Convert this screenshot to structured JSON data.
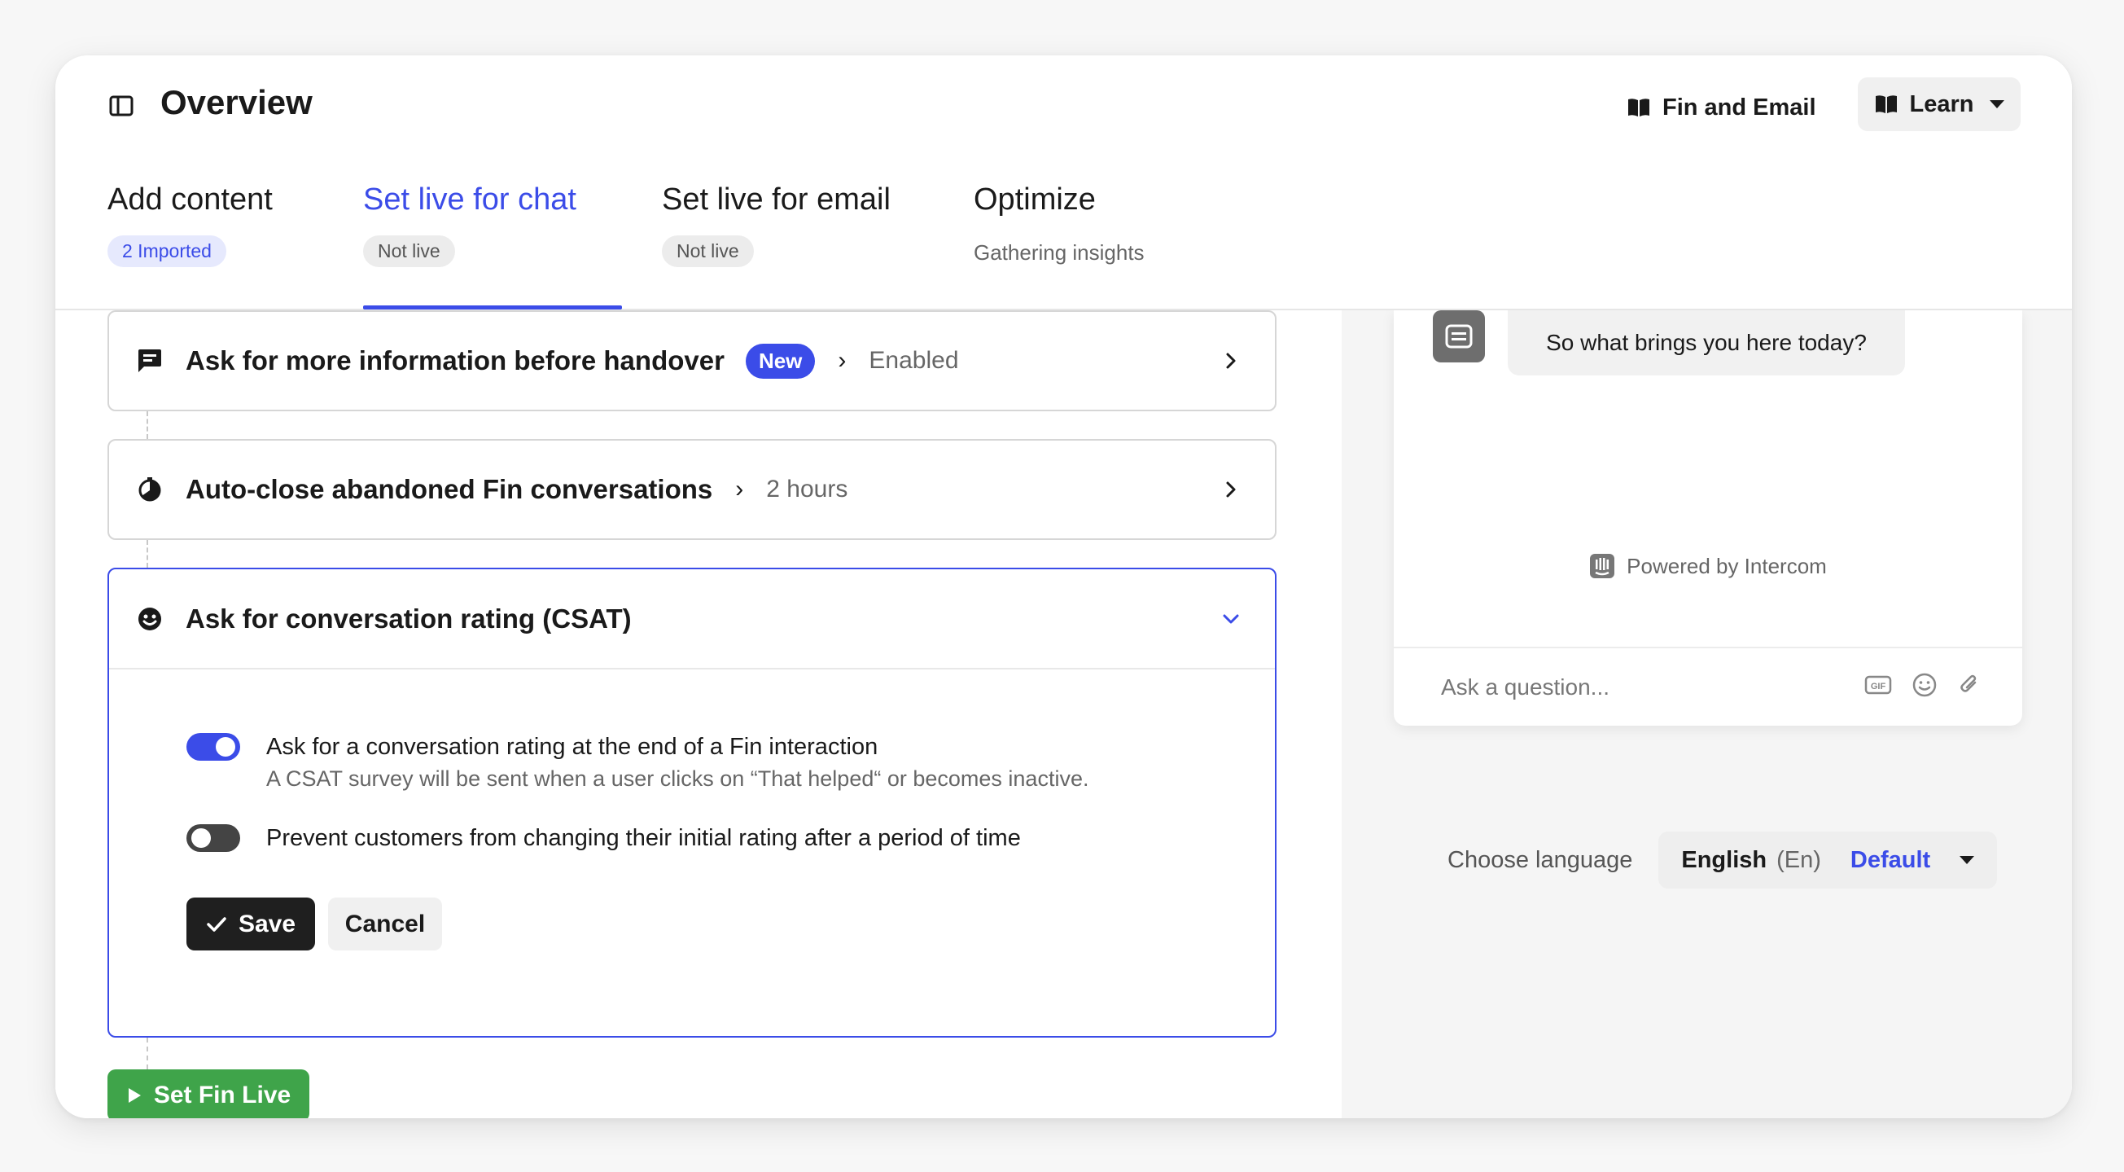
{
  "header": {
    "title": "Overview",
    "fin_email_label": "Fin and Email",
    "learn_label": "Learn"
  },
  "tabs": [
    {
      "label": "Add content",
      "badge": "2 Imported"
    },
    {
      "label": "Set live for chat",
      "badge": "Not live",
      "active": true
    },
    {
      "label": "Set live for email",
      "badge": "Not live"
    },
    {
      "label": "Optimize",
      "sub": "Gathering insights"
    }
  ],
  "cards": {
    "handover": {
      "title": "Ask for more information before handover",
      "pill": "New",
      "arrow": "›",
      "value": "Enabled"
    },
    "autoclose": {
      "title": "Auto-close abandoned Fin conversations",
      "arrow": "›",
      "value": "2 hours"
    },
    "csat": {
      "title": "Ask for conversation rating (CSAT)",
      "option1_label": "Ask for a conversation rating at the end of a Fin interaction",
      "option1_help": "A CSAT survey will be sent when a user clicks on “That helped“ or becomes inactive.",
      "option1_enabled": true,
      "option2_label": "Prevent customers from changing their initial rating after a period of time",
      "option2_enabled": false,
      "save_label": "Save",
      "cancel_label": "Cancel"
    }
  },
  "set_live_label": "Set Fin Live",
  "preview": {
    "bot_message": "So what brings you here today?",
    "powered_by": "Powered by Intercom",
    "composer_placeholder": "Ask a question...",
    "choose_language_label": "Choose language",
    "language_name": "English",
    "language_code": "(En)",
    "language_default": "Default"
  },
  "colors": {
    "accent": "#3b4ce8",
    "live_green": "#3fa44a",
    "save_dark": "#1f1f1f"
  }
}
